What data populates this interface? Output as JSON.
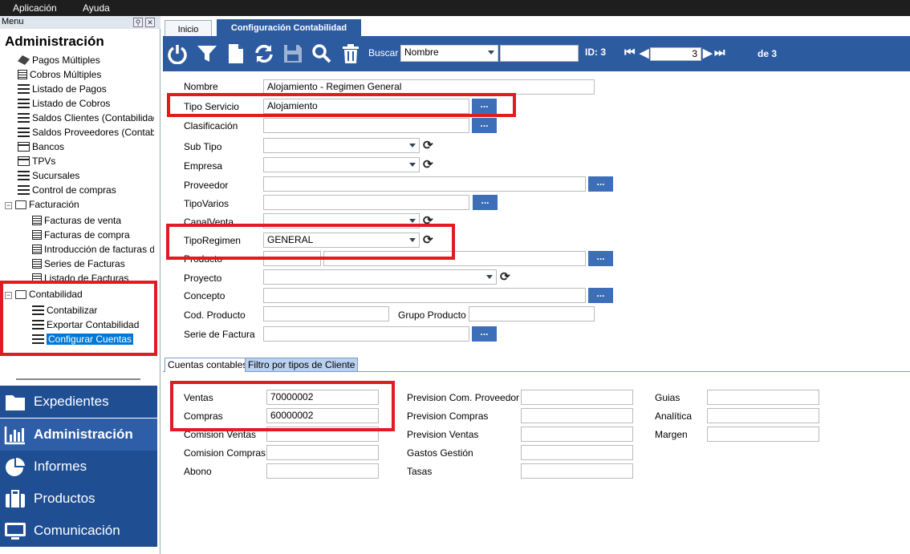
{
  "menubar": {
    "items": [
      "Aplicación",
      "Ayuda"
    ]
  },
  "sidebar": {
    "menu_label": "Menu",
    "title": "Administración",
    "items": [
      {
        "label": "Pagos Múltiples",
        "icon": "payment-icon"
      },
      {
        "label": "Cobros Múltiples",
        "icon": "document-icon"
      },
      {
        "label": "Listado de Pagos",
        "icon": "list-icon"
      },
      {
        "label": "Listado de Cobros",
        "icon": "list-icon"
      },
      {
        "label": "Saldos Clientes (Contabilidad",
        "icon": "list-icon"
      },
      {
        "label": "Saldos Proveedores (Contabil",
        "icon": "list-icon"
      },
      {
        "label": "Bancos",
        "icon": "card-icon"
      },
      {
        "label": "TPVs",
        "icon": "card-icon"
      },
      {
        "label": "Sucursales",
        "icon": "list-icon"
      },
      {
        "label": "Control de compras",
        "icon": "list-icon"
      }
    ],
    "facturacion": {
      "label": "Facturación",
      "items": [
        "Facturas de venta",
        "Facturas de compra",
        "Introducción de facturas d",
        "Series de Facturas",
        "Listado de Facturas"
      ]
    },
    "contabilidad": {
      "label": "Contabilidad",
      "items": [
        "Contabilizar",
        "Exportar Contabilidad",
        "Configurar Cuentas"
      ]
    },
    "nav": [
      "Expedientes",
      "Administración",
      "Informes",
      "Productos",
      "Comunicación"
    ]
  },
  "tabs": [
    "Inicio",
    "Configuración Contabilidad"
  ],
  "toolbar": {
    "buscar_label": "Buscar",
    "buscar_field": "Nombre",
    "search_value": "",
    "id_label": "ID: 3",
    "page_value": "3",
    "of_label": "de 3"
  },
  "form": {
    "nombre": {
      "label": "Nombre",
      "value": "Alojamiento - Regimen General"
    },
    "tipo_servicio": {
      "label": "Tipo Servicio",
      "value": "Alojamiento"
    },
    "clasificacion": {
      "label": "Clasificación",
      "value": ""
    },
    "sub_tipo": {
      "label": "Sub Tipo",
      "value": ""
    },
    "empresa": {
      "label": "Empresa",
      "value": ""
    },
    "proveedor": {
      "label": "Proveedor",
      "value": ""
    },
    "tipo_varios": {
      "label": "TipoVarios",
      "value": ""
    },
    "canal_venta": {
      "label": "CanalVenta",
      "value": ""
    },
    "tipo_regimen": {
      "label": "TipoRegimen",
      "value": "GENERAL"
    },
    "producto": {
      "label": "Producto",
      "value": ""
    },
    "proyecto": {
      "label": "Proyecto",
      "value": ""
    },
    "concepto": {
      "label": "Concepto",
      "value": ""
    },
    "cod_producto": {
      "label": "Cod. Producto",
      "value": ""
    },
    "grupo_producto": {
      "label": "Grupo Producto",
      "value": ""
    },
    "serie_factura": {
      "label": "Serie de Factura",
      "value": ""
    },
    "dots": "..."
  },
  "subtabs": [
    "Cuentas contables",
    "Filtro por tipos de Cliente"
  ],
  "cuentas": {
    "col1": [
      {
        "label": "Ventas",
        "value": "70000002"
      },
      {
        "label": "Compras",
        "value": "60000002"
      },
      {
        "label": "Comision Ventas",
        "value": ""
      },
      {
        "label": "Comision Compras",
        "value": ""
      },
      {
        "label": "Abono",
        "value": ""
      }
    ],
    "col2": [
      {
        "label": "Prevision Com. Proveedor",
        "value": ""
      },
      {
        "label": "Prevision Compras",
        "value": ""
      },
      {
        "label": "Prevision Ventas",
        "value": ""
      },
      {
        "label": "Gastos Gestión",
        "value": ""
      },
      {
        "label": "Tasas",
        "value": ""
      }
    ],
    "col3": [
      {
        "label": "Guias",
        "value": ""
      },
      {
        "label": "Analítica",
        "value": ""
      },
      {
        "label": "Margen",
        "value": ""
      }
    ]
  },
  "colors": {
    "toolbar": "#2d5ba0",
    "nav": "#1f4e93",
    "highlight": "#e01b22",
    "button": "#3c6fb8"
  }
}
